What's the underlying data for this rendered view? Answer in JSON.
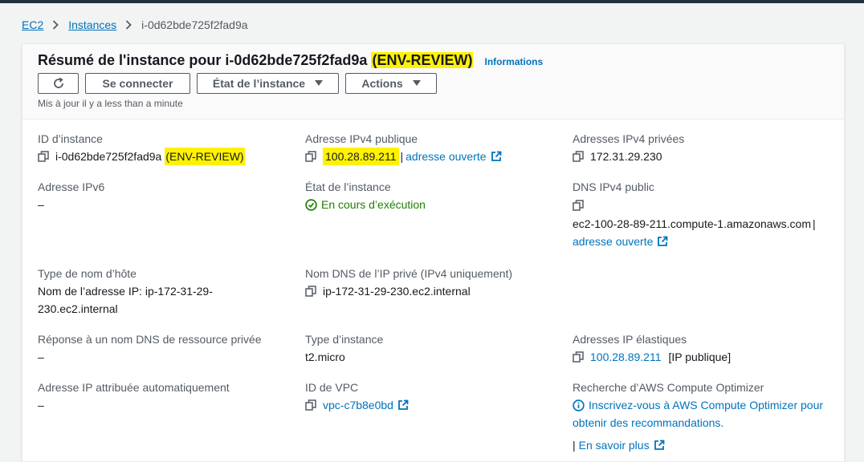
{
  "breadcrumb": {
    "ec2": "EC2",
    "instances": "Instances",
    "current": "i-0d62bde725f2fad9a"
  },
  "summary": {
    "title_prefix": "Résumé de l'instance pour i-0d62bde725f2fad9a",
    "title_tag": "(ENV-REVIEW)",
    "info_link": "Informations",
    "connect_label": "Se connecter",
    "state_label": "État de l’instance",
    "actions_label": "Actions",
    "updated_text": "Mis à jour il y a less than a minute"
  },
  "details": {
    "instance_id": {
      "label": "ID d’instance",
      "value": "i-0d62bde725f2fad9a",
      "tag": "(ENV-REVIEW)"
    },
    "public_ipv4": {
      "label": "Adresse IPv4 publique",
      "value": "100.28.89.211",
      "separator": "|",
      "open_link": "adresse ouverte"
    },
    "private_ipv4": {
      "label": "Adresses IPv4 privées",
      "value": "172.31.29.230"
    },
    "ipv6": {
      "label": "Adresse IPv6",
      "value": "–"
    },
    "instance_state": {
      "label": "État de l’instance",
      "value": "En cours d’exécution"
    },
    "public_dns": {
      "label": "DNS IPv4 public",
      "value": "ec2-100-28-89-211.compute-1.amazonaws.com",
      "separator": "|",
      "open_link": "adresse ouverte"
    },
    "hostname_type": {
      "label": "Type de nom d’hôte",
      "line1": "Nom de l’adresse IP: ip-172-31-29-",
      "line2": "230.ec2.internal"
    },
    "private_dns": {
      "label": "Nom DNS de l’IP privé (IPv4 uniquement)",
      "value": "ip-172-31-29-230.ec2.internal"
    },
    "dns_response": {
      "label": "Réponse à un nom DNS de ressource privée",
      "value": "–"
    },
    "instance_type": {
      "label": "Type d’instance",
      "value": "t2.micro"
    },
    "elastic_ips": {
      "label": "Adresses IP élastiques",
      "value": "100.28.89.211",
      "suffix": "[IP publique]"
    },
    "auto_ip": {
      "label": "Adresse IP attribuée automatiquement",
      "value": "–"
    },
    "vpc_id": {
      "label": "ID de VPC",
      "value": "vpc-c7b8e0bd"
    },
    "optimizer": {
      "label": "Recherche d’AWS Compute Optimizer",
      "line1": "Inscrivez-vous à AWS Compute Optimizer pour",
      "line2": "obtenir des recommandations.",
      "learn_more": "En savoir plus"
    }
  },
  "colors": {
    "link": "#0073bb",
    "highlight": "#fff200",
    "success": "#1d8102",
    "label": "#545b64"
  }
}
